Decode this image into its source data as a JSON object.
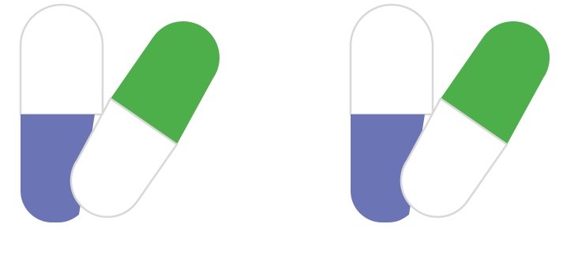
{
  "illustrations": [
    {
      "icon": "pill-capsules-icon",
      "colors": {
        "upright_top": "#ffffff",
        "upright_bottom": "#6b74b4",
        "tilted_top": "#4caf4a",
        "tilted_bottom": "#ffffff",
        "outline": "#d8d8d8"
      }
    },
    {
      "icon": "pill-capsules-icon",
      "colors": {
        "upright_top": "#ffffff",
        "upright_bottom": "#6b74b4",
        "tilted_top": "#4caf4a",
        "tilted_bottom": "#ffffff",
        "outline": "#d8d8d8"
      }
    }
  ]
}
